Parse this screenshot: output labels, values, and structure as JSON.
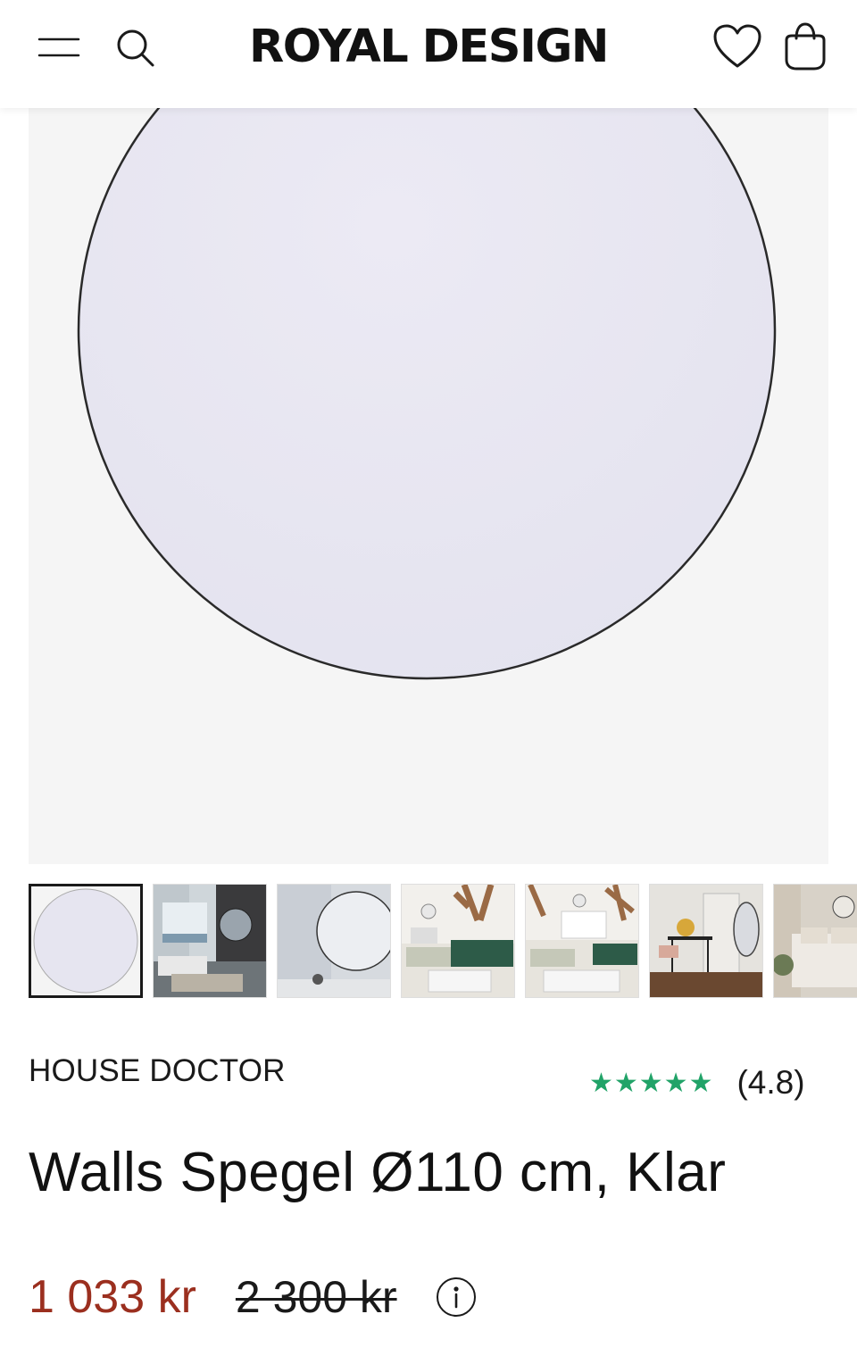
{
  "header": {
    "logo_text": "ROYAL DESIGN",
    "icons": [
      "menu-icon",
      "search-icon",
      "heart-icon",
      "shopping-bag-icon"
    ]
  },
  "gallery": {
    "main_image": "round-mirror",
    "thumbnails": [
      {
        "name": "thumb-mirror-product",
        "active": true
      },
      {
        "name": "thumb-living-room-sea-view",
        "active": false
      },
      {
        "name": "thumb-mirror-on-wall",
        "active": false
      },
      {
        "name": "thumb-green-sofa-room",
        "active": false
      },
      {
        "name": "thumb-sofa-room-beams",
        "active": false
      },
      {
        "name": "thumb-desk-chair-room",
        "active": false
      },
      {
        "name": "thumb-bedroom",
        "active": false
      }
    ]
  },
  "product": {
    "brand": "HOUSE DOCTOR",
    "stars": "★★★★★",
    "rating": "(4.8)",
    "title": "Walls Spegel Ø110 cm, Klar",
    "price_current": "1 033 kr",
    "price_old": "2 300 kr",
    "info_icon": "info-icon"
  },
  "colors": {
    "price_sale": "#9b2f1f",
    "stars": "#21a368",
    "image_bg": "#f5f5f5"
  }
}
